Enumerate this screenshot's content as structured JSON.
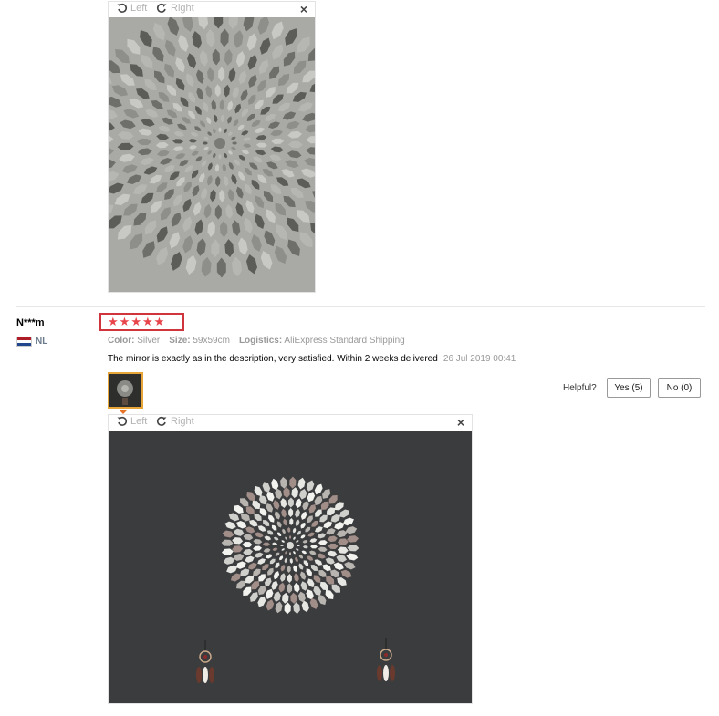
{
  "viewer1": {
    "left_label": "Left",
    "right_label": "Right",
    "close_label": "×"
  },
  "review": {
    "user": "N***m",
    "country": "NL",
    "rating_stars": 5,
    "stars": [
      "★",
      "★",
      "★",
      "★",
      "★"
    ],
    "color_label": "Color:",
    "color_value": "Silver",
    "size_label": "Size:",
    "size_value": "59x59cm",
    "logistics_label": "Logistics:",
    "logistics_value": "AliExpress Standard Shipping",
    "text": "The mirror is exactly as in the description, very satisfied. Within 2 weeks delivered",
    "date": "26 Jul 2019 00:41",
    "helpful_label": "Helpful?",
    "yes_label": "Yes (5)",
    "no_label": "No (0)"
  },
  "viewer2": {
    "left_label": "Left",
    "right_label": "Right",
    "close_label": "×"
  },
  "colors": {
    "star": "#e8454b",
    "highlight_box": "#d0343c",
    "thumb_border": "#e8a53a",
    "muted_text": "#999999"
  }
}
